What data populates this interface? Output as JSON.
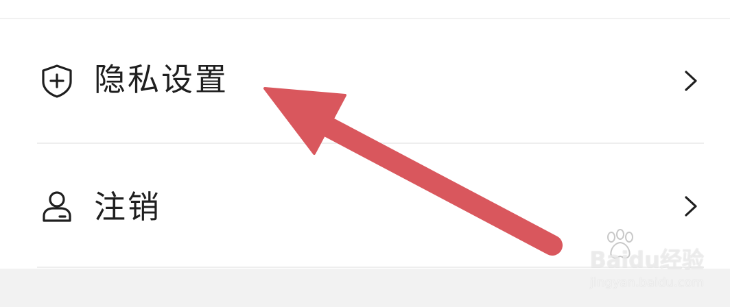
{
  "menu": {
    "privacy_label": "隐私设置",
    "logout_label": "注销"
  },
  "icons": {
    "privacy": "shield-plus-icon",
    "logout": "user-icon",
    "chevron": "chevron-right-icon"
  },
  "colors": {
    "arrow": "#d9575d",
    "text": "#1f1f1f",
    "divider": "#eeeeee"
  },
  "watermark": {
    "brand": "Baidu经验",
    "url": "jingyan.baidu.com"
  }
}
